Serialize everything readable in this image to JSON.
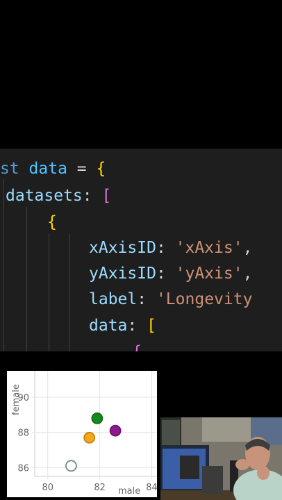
{
  "editor": {
    "lines": [
      [
        {
          "t": "st ",
          "c": "kw"
        },
        {
          "t": "data",
          "c": "var"
        },
        {
          "t": " = ",
          "c": "punc"
        },
        {
          "t": "{",
          "c": "brace"
        }
      ],
      [
        {
          "t": "datasets",
          "c": "prop"
        },
        {
          "t": ": ",
          "c": "punc"
        },
        {
          "t": "[",
          "c": "bracket"
        }
      ],
      [
        {
          "t": "{",
          "c": "brace"
        }
      ],
      [
        {
          "t": "xAxisID",
          "c": "prop"
        },
        {
          "t": ": ",
          "c": "punc"
        },
        {
          "t": "'xAxis'",
          "c": "str"
        },
        {
          "t": ",",
          "c": "punc"
        }
      ],
      [
        {
          "t": "yAxisID",
          "c": "prop"
        },
        {
          "t": ": ",
          "c": "punc"
        },
        {
          "t": "'yAxis'",
          "c": "str"
        },
        {
          "t": ",",
          "c": "punc"
        }
      ],
      [
        {
          "t": "label",
          "c": "prop"
        },
        {
          "t": ": ",
          "c": "punc"
        },
        {
          "t": "'Longevity",
          "c": "str"
        }
      ],
      [
        {
          "t": "data",
          "c": "prop"
        },
        {
          "t": ": ",
          "c": "punc"
        },
        {
          "t": "[",
          "c": "brace"
        }
      ],
      [
        {
          "t": "{",
          "c": "bracket"
        }
      ]
    ]
  },
  "chart_data": {
    "type": "scatter",
    "xlabel": "male",
    "ylabel": "female",
    "xlim": [
      79.5,
      84.2
    ],
    "ylim": [
      85.5,
      91.5
    ],
    "x_ticks": [
      "80",
      "82",
      "84"
    ],
    "y_ticks": [
      "86",
      "88",
      "90"
    ],
    "grid": true,
    "points": [
      {
        "x": 80.9,
        "y": 86.1,
        "color": "#ffffff",
        "stroke": "#6e8a84"
      },
      {
        "x": 81.6,
        "y": 87.7,
        "color": "#f5a623",
        "stroke": "#c78100"
      },
      {
        "x": 81.9,
        "y": 88.8,
        "color": "#138a1e",
        "stroke": "#0d6a15"
      },
      {
        "x": 82.6,
        "y": 88.1,
        "color": "#8b1a8f",
        "stroke": "#6a106d"
      }
    ]
  },
  "webcam": {
    "icon": "presenter-webcam"
  }
}
